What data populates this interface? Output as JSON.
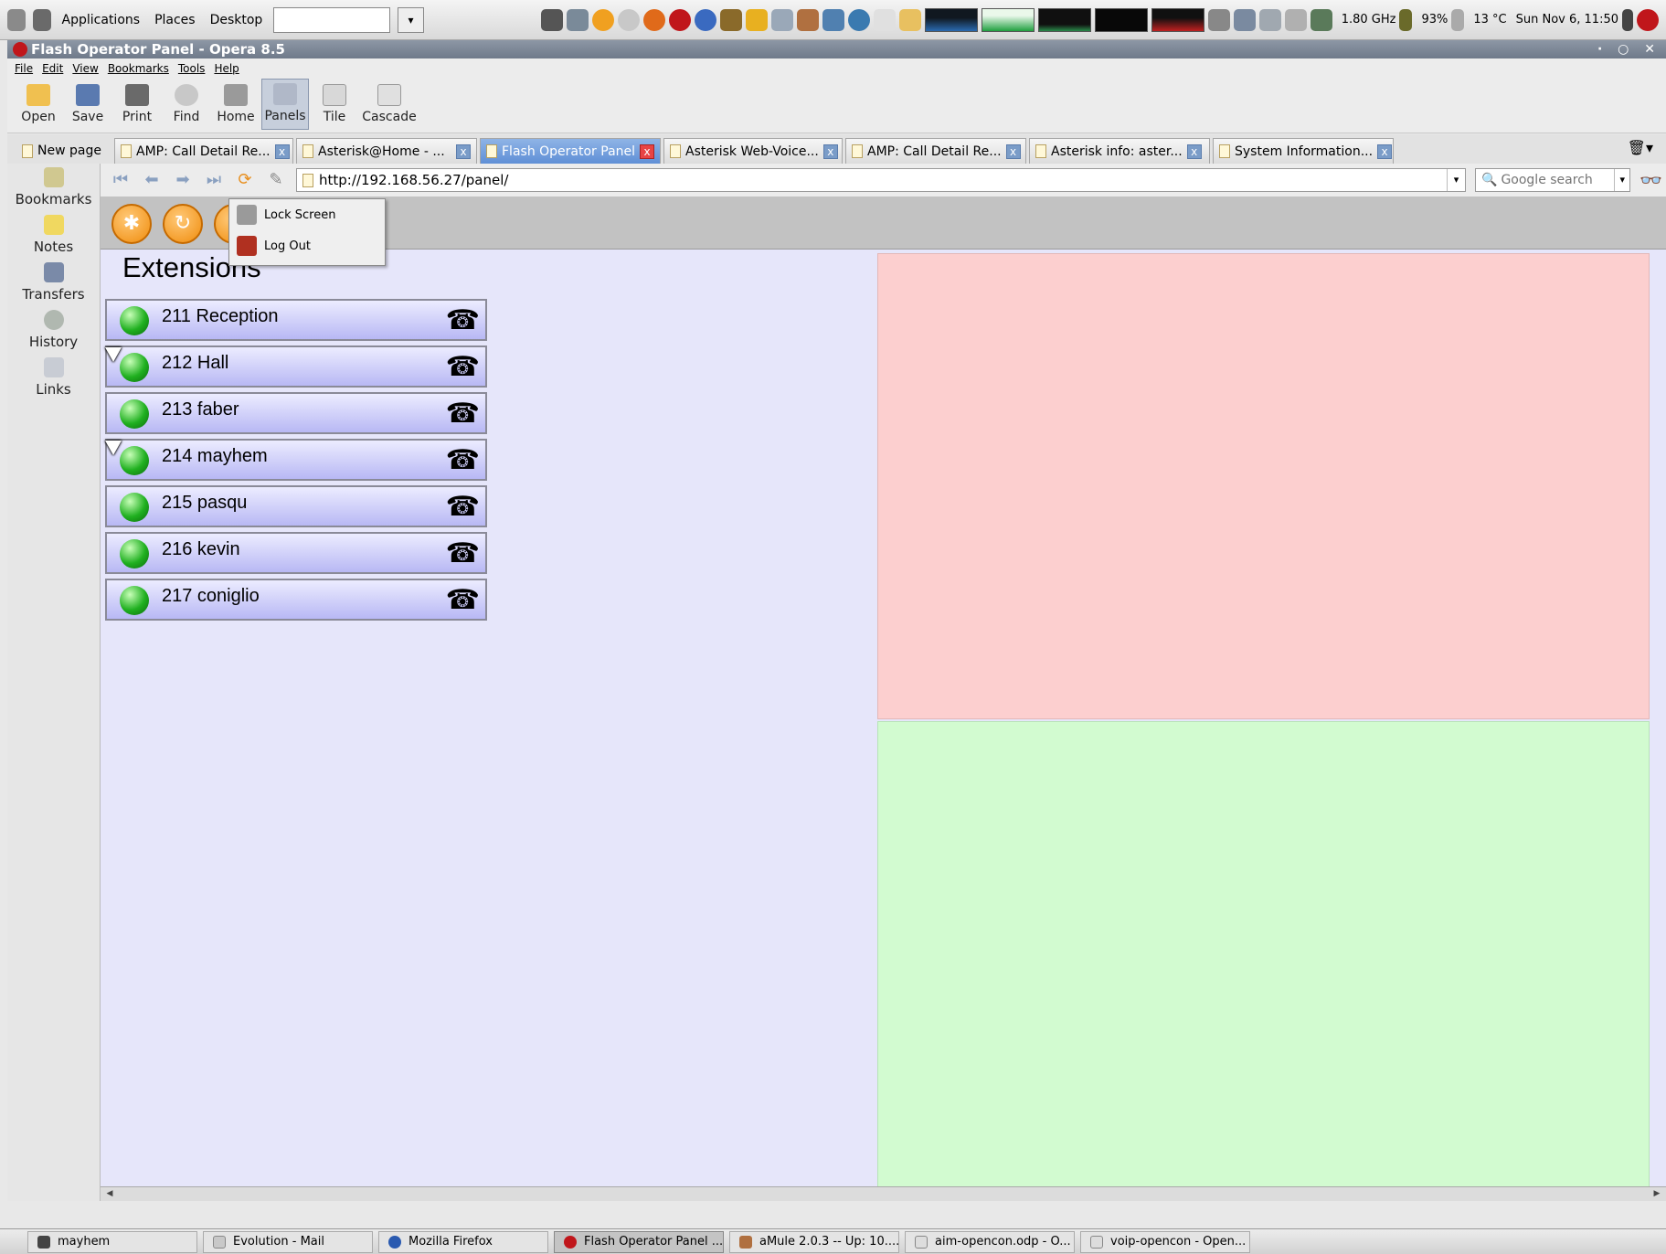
{
  "gnome_panel": {
    "menus": [
      "Applications",
      "Places",
      "Desktop"
    ],
    "cpu_freq": "1.80 GHz",
    "battery": "93%",
    "temperature": "13 °C",
    "clock": "Sun Nov 6, 11:50"
  },
  "window": {
    "title": "Flash Operator Panel - Opera 8.5"
  },
  "menubar": [
    "File",
    "Edit",
    "View",
    "Bookmarks",
    "Tools",
    "Help"
  ],
  "toolbar": {
    "open": "Open",
    "save": "Save",
    "print": "Print",
    "find": "Find",
    "home": "Home",
    "panels": "Panels",
    "tile": "Tile",
    "cascade": "Cascade"
  },
  "tabs": {
    "new_page": "New page",
    "items": [
      {
        "label": "AMP: Call Detail Re..."
      },
      {
        "label": "Asterisk@Home - ..."
      },
      {
        "label": "Flash Operator Panel"
      },
      {
        "label": "Asterisk Web-Voice..."
      },
      {
        "label": "AMP: Call Detail Re..."
      },
      {
        "label": "Asterisk info: aster..."
      },
      {
        "label": "System Information..."
      }
    ]
  },
  "sidebar": [
    "Bookmarks",
    "Notes",
    "Transfers",
    "History",
    "Links"
  ],
  "address": {
    "url": "http://192.168.56.27/panel/",
    "search_placeholder": "Google search"
  },
  "popup": {
    "lock_screen": "Lock Screen",
    "log_out": "Log Out"
  },
  "panel": {
    "title": "Extensions",
    "extensions": [
      {
        "label": "211 Reception"
      },
      {
        "label": "212 Hall"
      },
      {
        "label": "213 faber"
      },
      {
        "label": "214 mayhem"
      },
      {
        "label": "215 pasqu"
      },
      {
        "label": "216 kevin"
      },
      {
        "label": "217 coniglio"
      }
    ]
  },
  "taskbar": [
    {
      "label": "mayhem"
    },
    {
      "label": "Evolution - Mail"
    },
    {
      "label": "Mozilla Firefox"
    },
    {
      "label": "Flash Operator Panel ..."
    },
    {
      "label": "aMule 2.0.3 -- Up: 10...."
    },
    {
      "label": "aim-opencon.odp - O..."
    },
    {
      "label": "voip-opencon - Open..."
    }
  ],
  "colors": {
    "accent_tab": "#6f9ad9",
    "page_bg": "#e6e6fa",
    "red_panel": "#fccfcf",
    "green_panel": "#d2fbd0",
    "fop_button": "#f08c0c",
    "led_green": "#20b020"
  }
}
